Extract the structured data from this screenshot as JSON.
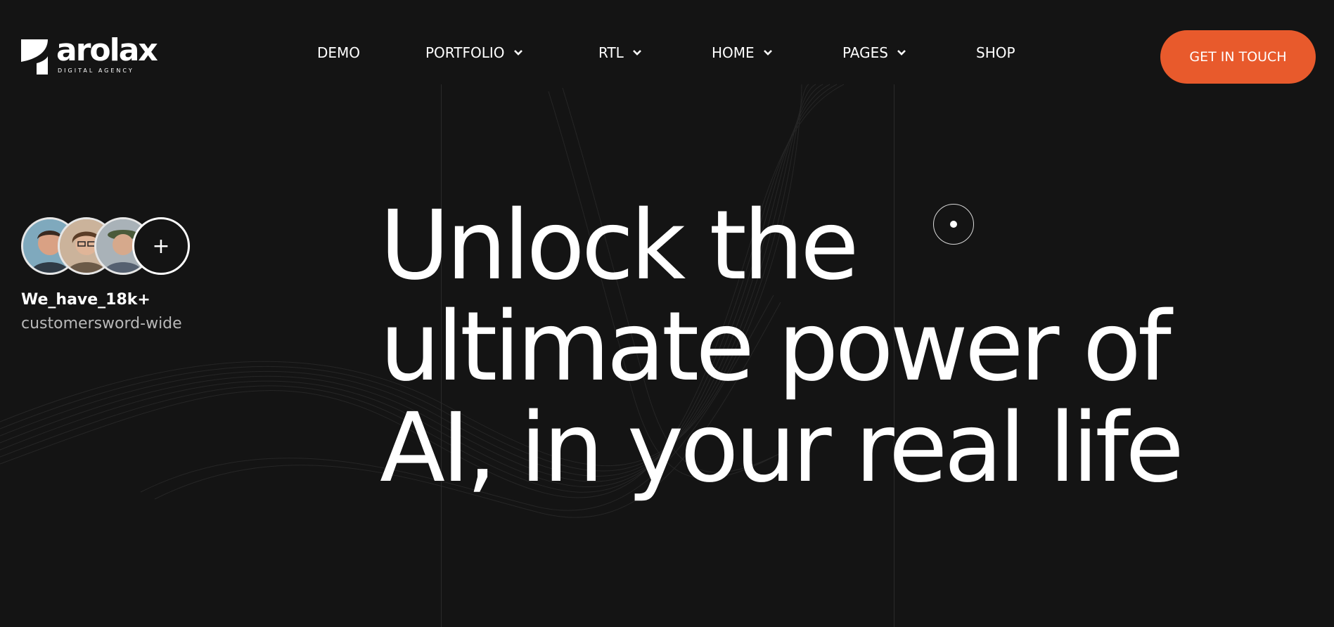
{
  "brand": {
    "name": "arolax",
    "tagline": "DIGITAL AGENCY"
  },
  "nav": {
    "items": [
      {
        "label": "DEMO",
        "has_dropdown": false
      },
      {
        "label": "PORTFOLIO",
        "has_dropdown": true
      },
      {
        "label": "RTL",
        "has_dropdown": true
      },
      {
        "label": "HOME",
        "has_dropdown": true
      },
      {
        "label": "PAGES",
        "has_dropdown": true
      },
      {
        "label": "SHOP",
        "has_dropdown": false
      }
    ]
  },
  "cta": {
    "label": "GET IN TOUCH",
    "color": "#e85a2c"
  },
  "customers": {
    "line1": "We_have_18k+",
    "line2": "customersword-wide",
    "plus_label": "+",
    "avatar_icons": [
      "avatar-person",
      "avatar-person",
      "avatar-person"
    ]
  },
  "hero": {
    "lines": [
      "Unlock the",
      "ultimate power of",
      "AI, in your real life"
    ]
  },
  "colors": {
    "background": "#141414",
    "accent": "#e85a2c",
    "text": "#ffffff",
    "muted": "#b8b8b8"
  }
}
